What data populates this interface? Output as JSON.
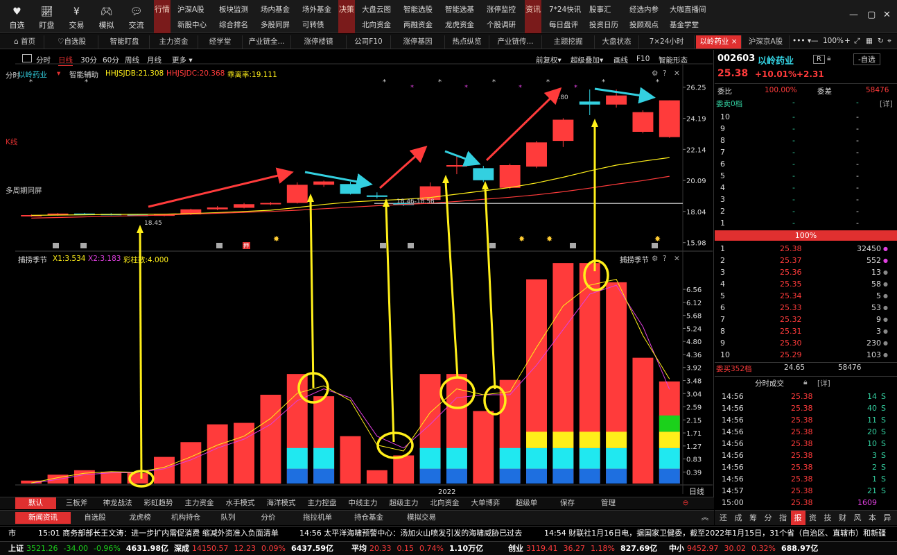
{
  "toolbar": {
    "icons": [
      {
        "label": "自选",
        "icon": "heart-icon"
      },
      {
        "label": "盯盘",
        "icon": "chart-icon"
      },
      {
        "label": "交易",
        "icon": "yen-icon"
      },
      {
        "label": "模拟",
        "icon": "gamepad-icon"
      },
      {
        "label": "交流",
        "icon": "chat-icon"
      }
    ],
    "tab_market": "行情",
    "tab_decision": "决策",
    "tab_info": "资讯",
    "market_links": [
      [
        "沪深A股",
        "新股中心"
      ],
      [
        "板块监测",
        "综合排名"
      ],
      [
        "场内基金",
        "多股同屏"
      ],
      [
        "场外基金",
        "可转债"
      ]
    ],
    "decision_links": [
      [
        "大盘云图",
        "北向资金"
      ],
      [
        "智能选股",
        "两融资金"
      ],
      [
        "智能选基",
        "龙虎资金"
      ],
      [
        "涨停监控",
        "个股调研"
      ]
    ],
    "info_links": [
      [
        "7*24快讯",
        "每日盘评"
      ],
      [
        "股事汇",
        "投资日历"
      ],
      [
        "经选内参",
        "投顾观点"
      ],
      [
        "大咖直播间",
        "基金学堂"
      ]
    ],
    "window_controls": [
      "—",
      "▢",
      "✕"
    ]
  },
  "tabs": [
    {
      "label": "首页"
    },
    {
      "label": "自选股"
    },
    {
      "label": "智能盯盘"
    },
    {
      "label": "主力资金"
    },
    {
      "label": "经学堂"
    },
    {
      "label": "产业链全..."
    },
    {
      "label": "涨停楼镜"
    },
    {
      "label": "公司F10"
    },
    {
      "label": "涨停基因"
    },
    {
      "label": "热点纵览"
    },
    {
      "label": "产业链传..."
    },
    {
      "label": "主题挖掘"
    },
    {
      "label": "大盘状态"
    },
    {
      "label": "7×24小时"
    },
    {
      "label": "以岭药业"
    },
    {
      "label": "沪深京A股"
    }
  ],
  "tabs_more": "••• ▾",
  "zoom": "100%",
  "periods": {
    "items": [
      "分时",
      "日线",
      "30分",
      "60分",
      "周线",
      "月线",
      "更多"
    ],
    "active": "日线"
  },
  "chart_toolbar": [
    "前复权",
    "超级叠加",
    "画线",
    "F10",
    "智能形态"
  ],
  "left_strip": [
    "分时",
    "K线",
    "多周期同屏"
  ],
  "main_panel": {
    "name": "以岭药业",
    "indicator": "智能辅助",
    "hhjsjdb": "HHJSJDB:21.308",
    "hhjsjdc": "HHJSJDC:20.368",
    "deviation": "乖离率:19.111",
    "y_ticks": [
      "26.25",
      "24.19",
      "22.14",
      "20.09",
      "18.04",
      "15.98"
    ],
    "annotations": [
      "18.45",
      "18.46-18.58",
      "28.80"
    ],
    "badge": "押"
  },
  "sub_panel": {
    "name": "捕捞季节",
    "x1": "X1:3.534",
    "x2": "X2:3.183",
    "extra": "彩柱数:4.000",
    "title_right": "捕捞季节",
    "y_ticks": [
      "6.56",
      "6.12",
      "5.68",
      "5.24",
      "4.80",
      "4.36",
      "3.92",
      "3.48",
      "3.04",
      "2.59",
      "2.15",
      "1.71",
      "1.27",
      "0.83",
      "0.39"
    ],
    "x_label": "2022",
    "period_label": "日线"
  },
  "chart_data": {
    "type": "candlestick",
    "candles": [
      {
        "o": 17.72,
        "c": 17.8,
        "h": 17.84,
        "l": 17.68
      },
      {
        "o": 17.8,
        "c": 17.9,
        "h": 17.94,
        "l": 17.76
      },
      {
        "o": 17.9,
        "c": 17.88,
        "h": 17.94,
        "l": 17.84
      },
      {
        "o": 17.88,
        "c": 17.82,
        "h": 17.92,
        "l": 17.78
      },
      {
        "o": 17.82,
        "c": 17.78,
        "h": 17.86,
        "l": 17.74
      },
      {
        "o": 17.78,
        "c": 17.84,
        "h": 17.88,
        "l": 17.72
      },
      {
        "o": 17.84,
        "c": 18.18,
        "h": 18.22,
        "l": 17.8
      },
      {
        "o": 18.18,
        "c": 18.3,
        "h": 18.4,
        "l": 18.12
      },
      {
        "o": 18.28,
        "c": 18.52,
        "h": 18.6,
        "l": 18.24
      },
      {
        "o": 18.52,
        "c": 18.6,
        "h": 18.66,
        "l": 18.46
      },
      {
        "o": 18.6,
        "c": 19.8,
        "h": 19.96,
        "l": 18.56
      },
      {
        "o": 19.8,
        "c": 20.02,
        "h": 20.08,
        "l": 19.66
      },
      {
        "o": 19.85,
        "c": 19.2,
        "h": 20.0,
        "l": 19.16
      },
      {
        "o": 19.1,
        "c": 19.0,
        "h": 19.3,
        "l": 18.9
      },
      {
        "o": 18.58,
        "c": 18.46,
        "h": 18.7,
        "l": 18.4
      },
      {
        "o": 18.8,
        "c": 19.7,
        "h": 19.96,
        "l": 18.7
      },
      {
        "o": 21.0,
        "c": 21.1,
        "h": 21.7,
        "l": 20.5
      },
      {
        "o": 20.9,
        "c": 20.1,
        "h": 21.05,
        "l": 19.98
      },
      {
        "o": 19.6,
        "c": 21.1,
        "h": 21.2,
        "l": 19.5
      },
      {
        "o": 21.0,
        "c": 22.6,
        "h": 22.7,
        "l": 20.9
      },
      {
        "o": 22.7,
        "c": 24.1,
        "h": 24.2,
        "l": 22.3
      },
      {
        "o": 25.3,
        "c": 25.1,
        "h": 26.1,
        "l": 24.4
      },
      {
        "o": 25.1,
        "c": 25.7,
        "h": 26.1,
        "l": 24.9
      },
      {
        "o": 23.3,
        "c": 24.6,
        "h": 24.72,
        "l": 23.2
      },
      {
        "o": 22.95,
        "c": 25.38,
        "h": 25.38,
        "l": 22.9
      }
    ],
    "ma_short": [
      17.78,
      17.8,
      17.82,
      17.84,
      17.85,
      17.86,
      17.9,
      17.96,
      18.04,
      18.12,
      18.3,
      18.5,
      18.66,
      18.76,
      18.84,
      18.96,
      19.18,
      19.4,
      19.62,
      19.92,
      20.3,
      20.72,
      21.1,
      21.36,
      21.6
    ],
    "ma_long": [
      17.6,
      17.64,
      17.68,
      17.72,
      17.76,
      17.8,
      17.86,
      17.92,
      17.98,
      18.04,
      18.12,
      18.22,
      18.32,
      18.42,
      18.5,
      18.58,
      18.7,
      18.84,
      18.98,
      19.14,
      19.34,
      19.58,
      19.84,
      20.08,
      20.36
    ],
    "reference_line": 18.57,
    "sub_bars": [
      0.1,
      0.3,
      0.45,
      0.4,
      0.35,
      0.9,
      1.4,
      2.0,
      2.05,
      3.0,
      3.7,
      2.95,
      1.6,
      0.45,
      0.95,
      3.7,
      3.7,
      2.45,
      3.5,
      6.9,
      7.45,
      7.45,
      6.8,
      4.25,
      3.45
    ],
    "sub_line_x1": [
      0.02,
      0.2,
      0.35,
      0.4,
      0.38,
      0.55,
      0.9,
      1.3,
      1.6,
      2.2,
      3.05,
      3.3,
      2.8,
      1.3,
      1.1,
      2.4,
      3.2,
      3.0,
      3.1,
      4.6,
      6.0,
      6.7,
      6.9,
      5.0,
      3.53
    ],
    "sub_line_x2": [
      0.01,
      0.14,
      0.3,
      0.36,
      0.37,
      0.5,
      0.8,
      1.2,
      1.5,
      2.0,
      2.8,
      3.2,
      2.9,
      1.6,
      1.2,
      2.0,
      2.9,
      3.0,
      3.0,
      4.0,
      5.2,
      6.4,
      6.7,
      5.3,
      3.18
    ]
  },
  "stock": {
    "code": "002603",
    "name": "以岭药业",
    "price": "25.38",
    "change_pct": "+10.01%",
    "change": "+2.31",
    "r_badge": "R",
    "watch_button": "-自选",
    "webi_label": "委比",
    "webi": "100.00%",
    "weicha_label": "委差",
    "weicha": "58476",
    "sell_title": "委卖0档",
    "sell_more": "[详]",
    "sell_levels": [
      {
        "n": "10",
        "p": "-",
        "v": "-"
      },
      {
        "n": "9",
        "p": "-",
        "v": "-"
      },
      {
        "n": "8",
        "p": "-",
        "v": "-"
      },
      {
        "n": "7",
        "p": "-",
        "v": "-"
      },
      {
        "n": "6",
        "p": "-",
        "v": "-"
      },
      {
        "n": "5",
        "p": "-",
        "v": "-"
      },
      {
        "n": "4",
        "p": "-",
        "v": "-"
      },
      {
        "n": "3",
        "p": "-",
        "v": "-"
      },
      {
        "n": "2",
        "p": "-",
        "v": "-"
      },
      {
        "n": "1",
        "p": "-",
        "v": "-"
      }
    ],
    "ratio_bar": "100%",
    "buy_levels": [
      {
        "n": "1",
        "p": "25.38",
        "v": "32450"
      },
      {
        "n": "2",
        "p": "25.37",
        "v": "552"
      },
      {
        "n": "3",
        "p": "25.36",
        "v": "13"
      },
      {
        "n": "4",
        "p": "25.35",
        "v": "58"
      },
      {
        "n": "5",
        "p": "25.34",
        "v": "5"
      },
      {
        "n": "6",
        "p": "25.33",
        "v": "53"
      },
      {
        "n": "7",
        "p": "25.32",
        "v": "9"
      },
      {
        "n": "8",
        "p": "25.31",
        "v": "3"
      },
      {
        "n": "9",
        "p": "25.30",
        "v": "230"
      },
      {
        "n": "10",
        "p": "25.29",
        "v": "103"
      }
    ],
    "buy_summary": {
      "label": "委买352档",
      "avg": "24.65",
      "total": "58476"
    },
    "ticks_title": "分时成交",
    "ticks_more": "[详]",
    "ticks": [
      {
        "t": "14:56",
        "p": "25.38",
        "v": "14",
        "s": "S"
      },
      {
        "t": "14:56",
        "p": "25.38",
        "v": "40",
        "s": "S"
      },
      {
        "t": "14:56",
        "p": "25.38",
        "v": "11",
        "s": "S"
      },
      {
        "t": "14:56",
        "p": "25.38",
        "v": "20",
        "s": "S"
      },
      {
        "t": "14:56",
        "p": "25.38",
        "v": "10",
        "s": "S"
      },
      {
        "t": "14:56",
        "p": "25.38",
        "v": "3",
        "s": "S"
      },
      {
        "t": "14:56",
        "p": "25.38",
        "v": "2",
        "s": "S"
      },
      {
        "t": "14:56",
        "p": "25.38",
        "v": "1",
        "s": "S"
      },
      {
        "t": "14:57",
        "p": "25.38",
        "v": "21",
        "s": "S"
      },
      {
        "t": "15:00",
        "p": "25.38",
        "v": "1609",
        "s": ""
      }
    ]
  },
  "bottom_tabs": [
    "默认",
    "三板斧",
    "神龙战法",
    "彩虹趋势",
    "主力资金",
    "水手模式",
    "海洋模式",
    "主力控盘",
    "中线主力",
    "超级主力",
    "北向资金",
    "大单博弈",
    "超级单",
    "保存",
    "管理"
  ],
  "news_tabs": [
    "新闻资讯",
    "自选股",
    "龙虎榜",
    "机构持仓",
    "队列",
    "分价",
    "拖拉机单",
    "持仓基金",
    "模拟交易"
  ],
  "right_tabs": [
    "还",
    "成",
    "筹",
    "分",
    "指",
    "报",
    "资",
    "技",
    "财",
    "风",
    "本",
    "异"
  ],
  "news": [
    {
      "time": "市",
      "text": ""
    },
    {
      "time": "15:01",
      "text": "商务部部长王文涛：进一步扩内需促消费 缩减外资准入负面清单"
    },
    {
      "time": "14:56",
      "text": "太平洋海啸预警中心：汤加火山喷发引发的海啸威胁已过去"
    },
    {
      "time": "14:54",
      "text": "财联社1月16日电，据国家卫健委，截至2022年1月15日，31个省（自治区、直辖市）和新疆"
    }
  ],
  "status": [
    {
      "name": "上证",
      "val": "3521.26",
      "chg": "-34.00",
      "pct": "-0.96%",
      "amt": "4631.98亿"
    },
    {
      "name": "深成",
      "val": "14150.57",
      "chg": "12.23",
      "pct": "0.09%",
      "amt": "6437.59亿"
    },
    {
      "name": "平均",
      "val": "20.33",
      "chg": "0.15",
      "pct": "0.74%",
      "amt": "1.10万亿"
    },
    {
      "name": "创业",
      "val": "3119.41",
      "chg": "36.27",
      "pct": "1.18%",
      "amt": "827.69亿"
    },
    {
      "name": "中小",
      "val": "9452.97",
      "chg": "30.02",
      "pct": "0.32%",
      "amt": "688.97亿"
    }
  ],
  "colors": {
    "up": "#ff3b3b",
    "down": "#33d0e0",
    "yellow": "#ffef1a",
    "accent": "#e03030",
    "magenta": "#e040e0",
    "neutral": "#ffffff"
  }
}
